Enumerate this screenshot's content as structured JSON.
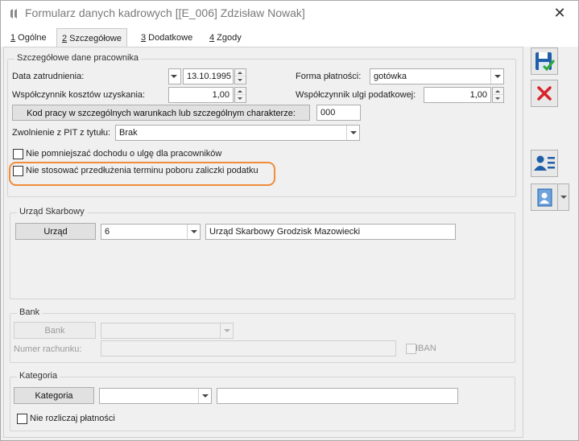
{
  "window": {
    "title": "Formularz danych kadrowych [[E_006] Zdzisław Nowak]",
    "close_glyph": "✕"
  },
  "tabs": [
    {
      "num": "1",
      "label": " Ogólne"
    },
    {
      "num": "2",
      "label": " Szczegółowe"
    },
    {
      "num": "3",
      "label": " Dodatkowe"
    },
    {
      "num": "4",
      "label": " Zgody"
    }
  ],
  "details": {
    "legend": "Szczegółowe dane pracownika",
    "hire_date_label": "Data zatrudnienia:",
    "hire_date_value": "13.10.1995",
    "payment_form_label": "Forma płatności:",
    "payment_form_value": "gotówka",
    "cost_coef_label": "Współczynnik kosztów uzyskania:",
    "cost_coef_value": "1,00",
    "tax_relief_coef_label": "Współczynnik ulgi podatkowej:",
    "tax_relief_coef_value": "1,00",
    "work_code_button": "Kod pracy w szczególnych warunkach lub szczególnym charakterze:",
    "work_code_value": "000",
    "pit_exemption_label": "Zwolnienie z PIT z tytułu:",
    "pit_exemption_value": "Brak",
    "checkbox_no_reduce_income": "Nie pomniejszać dochodu o ulgę dla pracowników",
    "checkbox_no_extension": "Nie stosować przedłużenia terminu poboru zaliczki podatku",
    "highlight_color": "#f08c3a"
  },
  "tax_office": {
    "legend": "Urząd Skarbowy",
    "button": "Urząd",
    "code": "6",
    "name": "Urząd Skarbowy Grodzisk Mazowiecki"
  },
  "bank": {
    "legend": "Bank",
    "button": "Bank",
    "bank_value": "",
    "account_label": "Numer rachunku:",
    "account_value": "",
    "iban_label": "IBAN"
  },
  "category": {
    "legend": "Kategoria",
    "button": "Kategoria",
    "code_value": "",
    "description_value": "",
    "checkbox_no_settle": "Nie rozliczaj płatności"
  },
  "sidebar": {
    "save_icon": "save-icon",
    "cancel_icon": "cancel-icon",
    "person_card_icon": "person-card-icon",
    "contact_icon": "contact-icon",
    "accent_blue": "#1f5fa8",
    "cancel_red": "#d8232a"
  }
}
